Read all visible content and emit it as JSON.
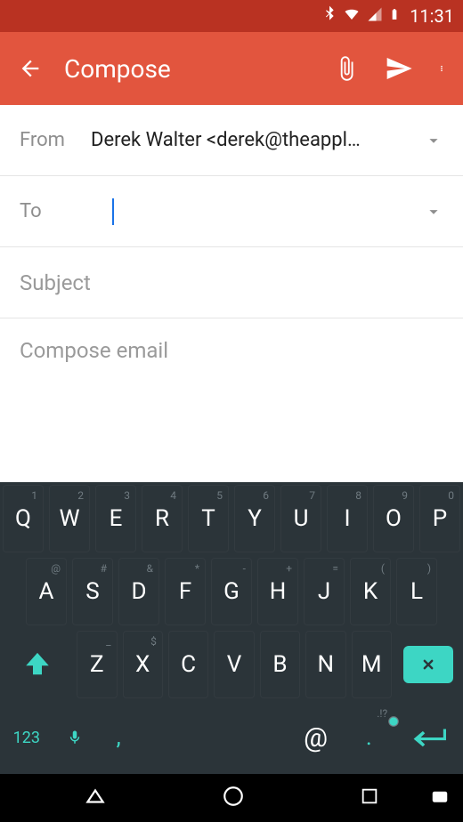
{
  "status": {
    "time": "11:31"
  },
  "appbar": {
    "title": "Compose"
  },
  "fields": {
    "from_label": "From",
    "from_value": "Derek Walter <derek@theappl…",
    "to_label": "To",
    "to_value": "",
    "subject_placeholder": "Subject",
    "body_placeholder": "Compose email"
  },
  "keyboard": {
    "r1": [
      {
        "k": "Q",
        "a": "1"
      },
      {
        "k": "W",
        "a": "2"
      },
      {
        "k": "E",
        "a": "3"
      },
      {
        "k": "R",
        "a": "4"
      },
      {
        "k": "T",
        "a": "5"
      },
      {
        "k": "Y",
        "a": "6"
      },
      {
        "k": "U",
        "a": "7"
      },
      {
        "k": "I",
        "a": "8"
      },
      {
        "k": "O",
        "a": "9"
      },
      {
        "k": "P",
        "a": "0"
      }
    ],
    "r2": [
      {
        "k": "A",
        "a": "@"
      },
      {
        "k": "S",
        "a": "#"
      },
      {
        "k": "D",
        "a": "&"
      },
      {
        "k": "F",
        "a": "*"
      },
      {
        "k": "G",
        "a": "-"
      },
      {
        "k": "H",
        "a": "+"
      },
      {
        "k": "J",
        "a": "="
      },
      {
        "k": "K",
        "a": "("
      },
      {
        "k": "L",
        "a": ")"
      }
    ],
    "r3": [
      {
        "k": "Z",
        "a": "_"
      },
      {
        "k": "X",
        "a": "$"
      },
      {
        "k": "C",
        "a": ""
      },
      {
        "k": "V",
        "a": ""
      },
      {
        "k": "B",
        "a": ""
      },
      {
        "k": "N",
        "a": ""
      },
      {
        "k": "M",
        "a": ""
      }
    ],
    "sym": "123",
    "comma": ",",
    "at": "@",
    "period": ".",
    "period_alt": ".!?"
  }
}
